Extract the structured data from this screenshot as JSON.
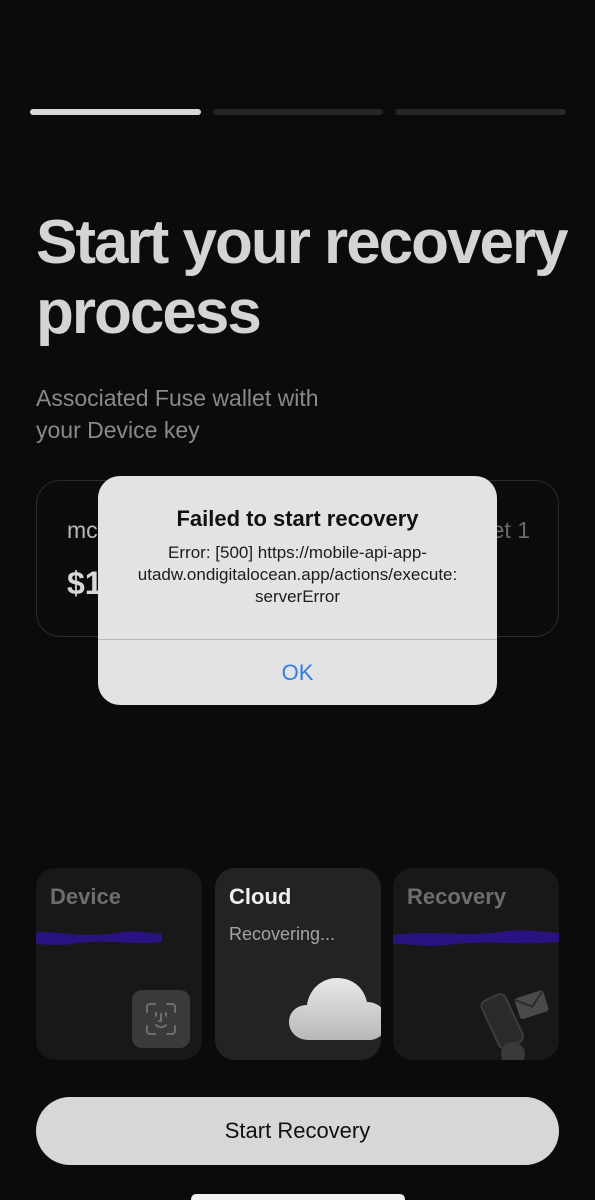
{
  "progress": {
    "total_steps": 3,
    "current_step": 1
  },
  "header": {
    "title": "Start your recovery process",
    "subtitle": "Associated Fuse wallet with your Device key"
  },
  "wallet": {
    "name": "mc",
    "tag": "et 1",
    "balance": "$1"
  },
  "keys": {
    "device": {
      "title": "Device",
      "icon": "face-id-icon"
    },
    "cloud": {
      "title": "Cloud",
      "status": "Recovering...",
      "icon": "cloud-icon"
    },
    "recovery": {
      "title": "Recovery",
      "icon": "phone-envelope-icon"
    }
  },
  "actions": {
    "start_recovery": "Start Recovery"
  },
  "alert": {
    "title": "Failed to start recovery",
    "message": "Error: [500] https://mobile-api-app-utadw.ondigitalocean.app/actions/execute: serverError",
    "ok_label": "OK"
  },
  "colors": {
    "background": "#0b0b0b",
    "accent_blue": "#2f7fe0",
    "redaction": "#2a1380",
    "button_bg": "#d7d7d7"
  }
}
